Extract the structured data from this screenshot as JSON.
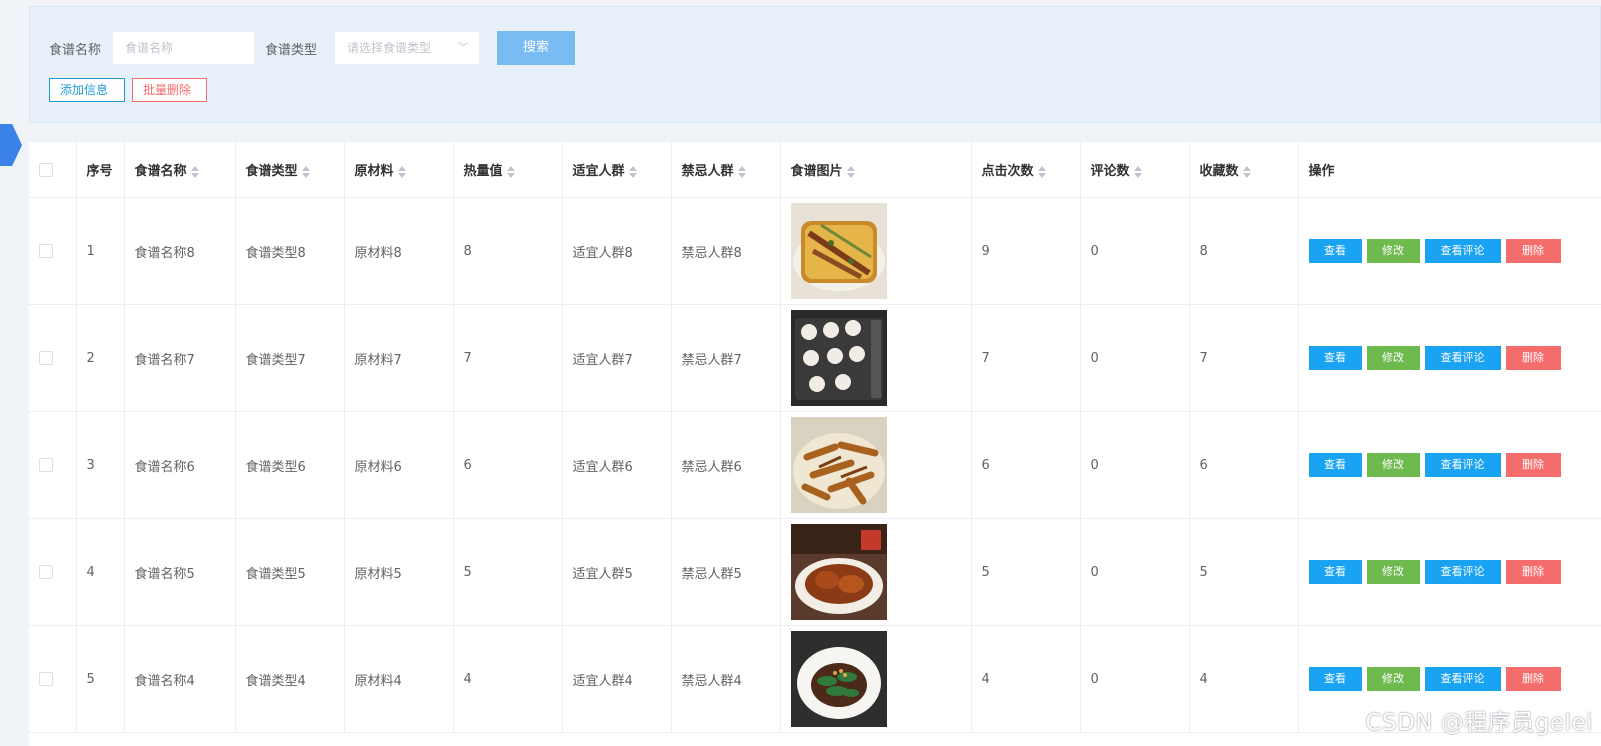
{
  "search": {
    "name_label": "食谱名称",
    "name_placeholder": "食谱名称",
    "type_label": "食谱类型",
    "type_placeholder": "请选择食谱类型",
    "search_button": "搜索",
    "add_button": "添加信息",
    "batch_delete_button": "批量删除"
  },
  "table": {
    "headers": [
      "序号",
      "食谱名称",
      "食谱类型",
      "原材料",
      "热量值",
      "适宜人群",
      "禁忌人群",
      "食谱图片",
      "点击次数",
      "评论数",
      "收藏数",
      "操作"
    ],
    "actions": {
      "view": "查看",
      "edit": "修改",
      "comments": "查看评论",
      "delete": "删除"
    },
    "rows": [
      {
        "idx": "1",
        "name": "食谱名称8",
        "type": "食谱类型8",
        "material": "原材料8",
        "calories": "8",
        "suitable": "适宜人群8",
        "taboo": "禁忌人群8",
        "image": "rolled-omelette",
        "clicks": "9",
        "comments": "0",
        "favorites": "8"
      },
      {
        "idx": "2",
        "name": "食谱名称7",
        "type": "食谱类型7",
        "material": "原材料7",
        "calories": "7",
        "suitable": "适宜人群7",
        "taboo": "禁忌人群7",
        "image": "dumplings-tray",
        "clicks": "7",
        "comments": "0",
        "favorites": "7"
      },
      {
        "idx": "3",
        "name": "食谱名称6",
        "type": "食谱类型6",
        "material": "原材料6",
        "calories": "6",
        "suitable": "适宜人群6",
        "taboo": "禁忌人群6",
        "image": "fried-strips",
        "clicks": "6",
        "comments": "0",
        "favorites": "6"
      },
      {
        "idx": "4",
        "name": "食谱名称5",
        "type": "食谱类型5",
        "material": "原材料5",
        "calories": "5",
        "suitable": "适宜人群5",
        "taboo": "禁忌人群5",
        "image": "braised-dish",
        "clicks": "5",
        "comments": "0",
        "favorites": "5"
      },
      {
        "idx": "5",
        "name": "食谱名称4",
        "type": "食谱类型4",
        "material": "原材料4",
        "calories": "4",
        "suitable": "适宜人群4",
        "taboo": "禁忌人群4",
        "image": "cucumber-salad",
        "clicks": "4",
        "comments": "0",
        "favorites": "4"
      }
    ]
  },
  "watermark": "CSDN @程序员gelei",
  "colors": {
    "primary": "#1aa3f2",
    "success": "#6fba4f",
    "danger": "#f56c6c",
    "search": "#79bbf3"
  }
}
